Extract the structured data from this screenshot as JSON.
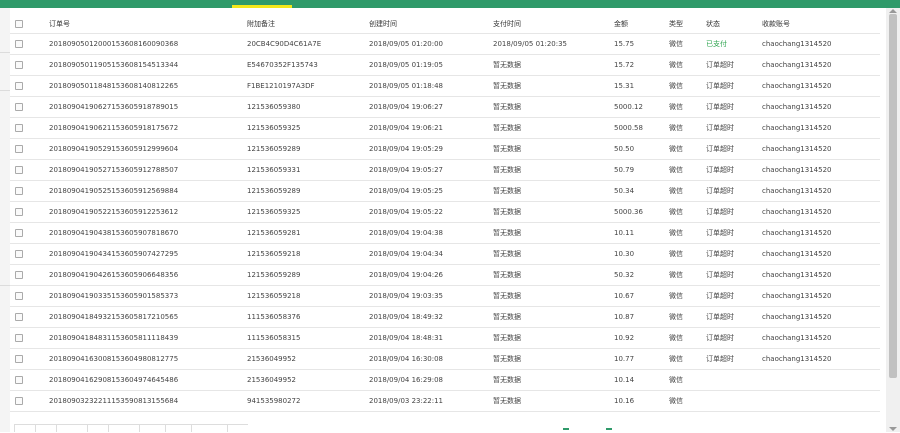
{
  "columns": [
    "",
    "订单号",
    "附加备注",
    "创建时间",
    "支付时间",
    "金额",
    "类型",
    "状态",
    "收款账号"
  ],
  "rows": [
    {
      "order_no": "201809050120001536081600903​68",
      "note": "20CB4C90D4C61A7E",
      "created": "2018/09/05 01:20:00",
      "paid": "2018/09/05 01:20:35",
      "amount": "15.75",
      "type": "微信",
      "status": "已支付",
      "status_ok": true,
      "account": "chaochang1314520"
    },
    {
      "order_no": "20180905011905153608154513344",
      "note": "E54670352F135743",
      "created": "2018/09/05 01:19:05",
      "paid": "暂无数据",
      "amount": "15.72",
      "type": "微信",
      "status": "订单超时",
      "status_ok": false,
      "account": "chaochang1314520"
    },
    {
      "order_no": "20180905011848153608140812265",
      "note": "F1BE1210197A3DF",
      "created": "2018/09/05 01:18:48",
      "paid": "暂无数据",
      "amount": "15.31",
      "type": "微信",
      "status": "订单超时",
      "status_ok": false,
      "account": "chaochang1314520"
    },
    {
      "order_no": "20180904190627153605918789015",
      "note": "121536059380",
      "created": "2018/09/04 19:06:27",
      "paid": "暂无数据",
      "amount": "5000.12",
      "type": "微信",
      "status": "订单超时",
      "status_ok": false,
      "account": "chaochang1314520"
    },
    {
      "order_no": "20180904190621153605918175672",
      "note": "121536059325",
      "created": "2018/09/04 19:06:21",
      "paid": "暂无数据",
      "amount": "5000.58",
      "type": "微信",
      "status": "订单超时",
      "status_ok": false,
      "account": "chaochang1314520"
    },
    {
      "order_no": "20180904190529153605912999604",
      "note": "121536059289",
      "created": "2018/09/04 19:05:29",
      "paid": "暂无数据",
      "amount": "50.50",
      "type": "微信",
      "status": "订单超时",
      "status_ok": false,
      "account": "chaochang1314520"
    },
    {
      "order_no": "20180904190527153605912788507",
      "note": "121536059331",
      "created": "2018/09/04 19:05:27",
      "paid": "暂无数据",
      "amount": "50.79",
      "type": "微信",
      "status": "订单超时",
      "status_ok": false,
      "account": "chaochang1314520"
    },
    {
      "order_no": "20180904190525153605912569884",
      "note": "121536059289",
      "created": "2018/09/04 19:05:25",
      "paid": "暂无数据",
      "amount": "50.34",
      "type": "微信",
      "status": "订单超时",
      "status_ok": false,
      "account": "chaochang1314520"
    },
    {
      "order_no": "20180904190522153605912253612",
      "note": "121536059325",
      "created": "2018/09/04 19:05:22",
      "paid": "暂无数据",
      "amount": "5000.36",
      "type": "微信",
      "status": "订单超时",
      "status_ok": false,
      "account": "chaochang1314520"
    },
    {
      "order_no": "20180904190438153605907818670",
      "note": "121536059281",
      "created": "2018/09/04 19:04:38",
      "paid": "暂无数据",
      "amount": "10.11",
      "type": "微信",
      "status": "订单超时",
      "status_ok": false,
      "account": "chaochang1314520"
    },
    {
      "order_no": "20180904190434153605907427295",
      "note": "121536059218",
      "created": "2018/09/04 19:04:34",
      "paid": "暂无数据",
      "amount": "10.30",
      "type": "微信",
      "status": "订单超时",
      "status_ok": false,
      "account": "chaochang1314520"
    },
    {
      "order_no": "20180904190426153605906648356",
      "note": "121536059289",
      "created": "2018/09/04 19:04:26",
      "paid": "暂无数据",
      "amount": "50.32",
      "type": "微信",
      "status": "订单超时",
      "status_ok": false,
      "account": "chaochang1314520"
    },
    {
      "order_no": "20180904190335153605901585373",
      "note": "121536059218",
      "created": "2018/09/04 19:03:35",
      "paid": "暂无数据",
      "amount": "10.67",
      "type": "微信",
      "status": "订单超时",
      "status_ok": false,
      "account": "chaochang1314520"
    },
    {
      "order_no": "20180904184932153605817210565",
      "note": "111536058376",
      "created": "2018/09/04 18:49:32",
      "paid": "暂无数据",
      "amount": "10.87",
      "type": "微信",
      "status": "订单超时",
      "status_ok": false,
      "account": "chaochang1314520"
    },
    {
      "order_no": "20180904184831153605811118439",
      "note": "111536058315",
      "created": "2018/09/04 18:48:31",
      "paid": "暂无数据",
      "amount": "10.92",
      "type": "微信",
      "status": "订单超时",
      "status_ok": false,
      "account": "chaochang1314520"
    },
    {
      "order_no": "20180904163008153604980812775",
      "note": "21536049952",
      "created": "2018/09/04 16:30:08",
      "paid": "暂无数据",
      "amount": "10.77",
      "type": "微信",
      "status": "订单超时",
      "status_ok": false,
      "account": "chaochang1314520"
    },
    {
      "order_no": "20180904162908153604974645486",
      "note": "21536049952",
      "created": "2018/09/04 16:29:08",
      "paid": "暂无数据",
      "amount": "10.14",
      "type": "微信",
      "status": "",
      "status_ok": false,
      "account": ""
    },
    {
      "order_no": "20180903232211153590813155684",
      "note": "941535980272",
      "created": "2018/09/03 23:22:11",
      "paid": "暂无数据",
      "amount": "10.16",
      "type": "微信",
      "status": "",
      "status_ok": false,
      "account": ""
    }
  ],
  "colors": {
    "topbar": "#2f9a6a",
    "topbar_tab": "#f3e81b",
    "status_paid": "#2ea44f"
  }
}
